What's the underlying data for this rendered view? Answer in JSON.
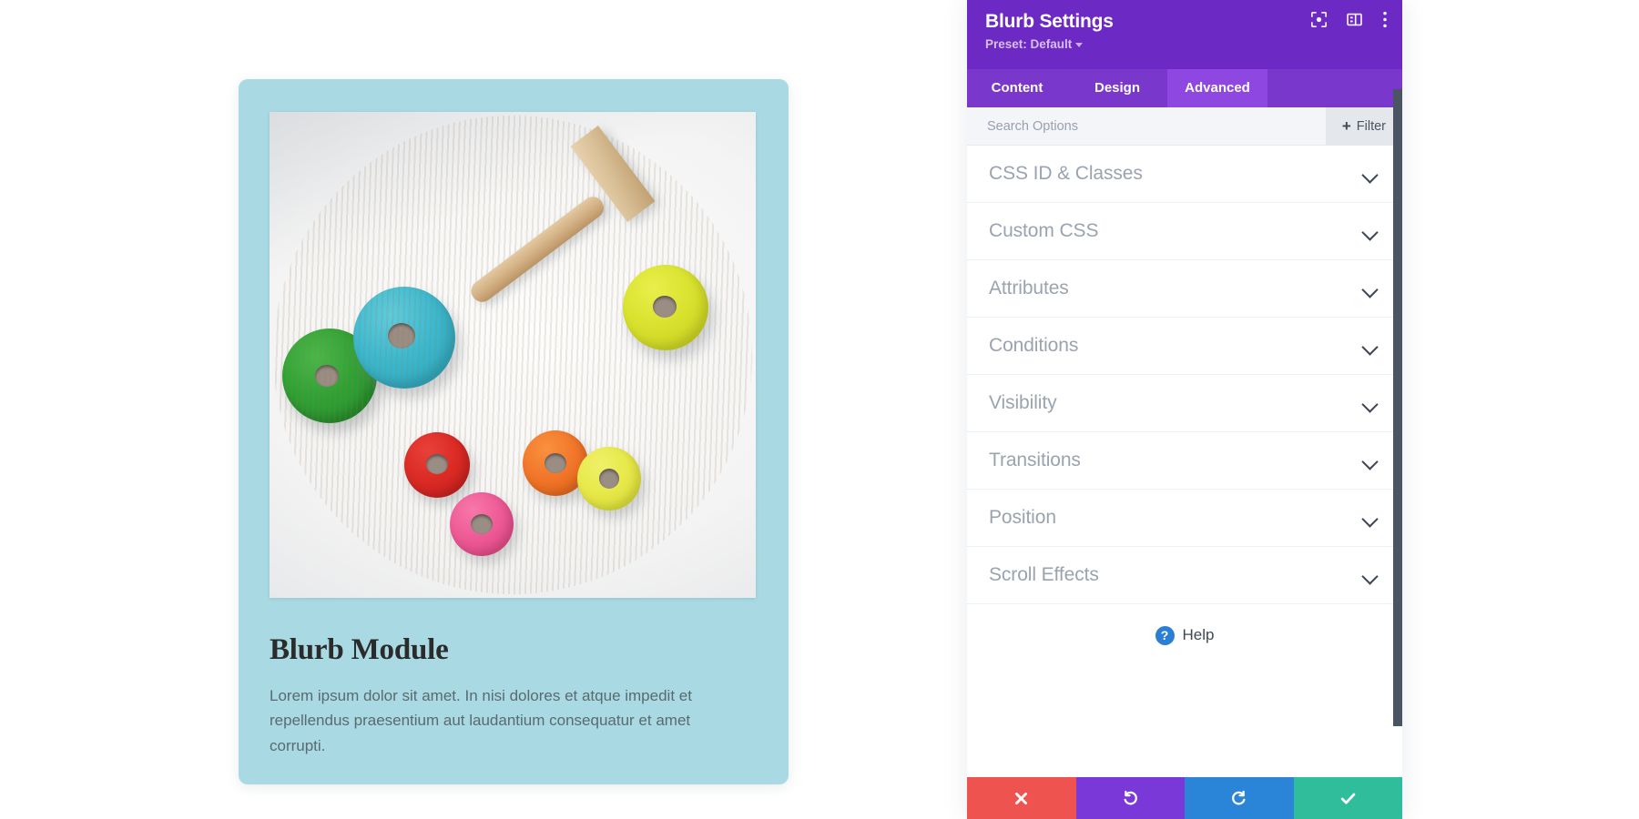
{
  "preview": {
    "card": {
      "title": "Blurb Module",
      "body": "Lorem ipsum dolor sit amet. In nisi dolores et atque impedit et repellendus praesentium aut laudantium consequatur et amet corrupti.",
      "background_color": "#a9d9e3",
      "image_alt": "wooden-toy-rings-and-hammer-photo"
    }
  },
  "panel": {
    "title": "Blurb Settings",
    "preset_label": "Preset: Default",
    "header_color": "#6d29c4",
    "tab_bar_color": "#7a37cc",
    "active_tab_color": "#8e47e0",
    "header_icons": [
      {
        "name": "focus-frame-icon",
        "label": "Focus"
      },
      {
        "name": "layout-panel-icon",
        "label": "Panel Layout"
      },
      {
        "name": "kebab-menu-icon",
        "label": "More Options"
      }
    ],
    "tabs": [
      {
        "label": "Content",
        "active": false
      },
      {
        "label": "Design",
        "active": false
      },
      {
        "label": "Advanced",
        "active": true
      }
    ],
    "search": {
      "placeholder": "Search Options",
      "value": ""
    },
    "filter_button": {
      "label": "Filter",
      "icon": "plus-icon"
    },
    "sections": [
      {
        "label": "CSS ID & Classes",
        "expanded": false
      },
      {
        "label": "Custom CSS",
        "expanded": false
      },
      {
        "label": "Attributes",
        "expanded": false
      },
      {
        "label": "Conditions",
        "expanded": false
      },
      {
        "label": "Visibility",
        "expanded": false
      },
      {
        "label": "Transitions",
        "expanded": false
      },
      {
        "label": "Position",
        "expanded": false
      },
      {
        "label": "Scroll Effects",
        "expanded": false
      }
    ],
    "help": {
      "label": "Help",
      "icon": "question-circle-icon",
      "icon_color": "#2a7fd4"
    },
    "footer_buttons": [
      {
        "name": "cancel-button",
        "icon": "times-icon",
        "glyph": "✖",
        "color": "#ef5350"
      },
      {
        "name": "undo-button",
        "icon": "undo-arrow-icon",
        "glyph": "↺",
        "color": "#7b38d8"
      },
      {
        "name": "redo-button",
        "icon": "redo-arrow-icon",
        "glyph": "↻",
        "color": "#2a85d8"
      },
      {
        "name": "save-button",
        "icon": "check-icon",
        "glyph": "✔",
        "color": "#2fbd9b"
      }
    ]
  }
}
